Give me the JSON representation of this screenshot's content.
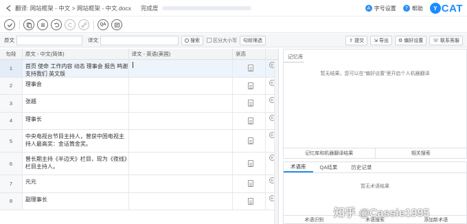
{
  "titlebar": {
    "breadcrumb": "翻译: 网站框架 - 中文 > 网站框架 - 中文.docx",
    "progress_label": "完成度",
    "progress_fraction": 0,
    "font_settings": "字号设置",
    "help": "帮助",
    "logo_badge": "Y",
    "logo_text": "CAT"
  },
  "toolbar": {
    "icons": [
      "confirm-icon",
      "copy-source-icon",
      "merge-icon",
      "undo-icon",
      "redo-icon",
      "link-icon",
      "qa-icon",
      "find-replace-icon"
    ],
    "qa_label": "QA"
  },
  "searchbar": {
    "source_label": "原文",
    "target_label": "译文",
    "search_button": "搜索",
    "case_sensitive": "区分大小写",
    "segment_filter": "句段筛选",
    "submit": "提交",
    "export": "导出",
    "preferences": "偏好设置",
    "contact": "联系客服"
  },
  "table": {
    "headers": [
      "句段",
      "原文 - 中文(简体)",
      "译文 - 英语(美国)",
      "状态"
    ],
    "rows": [
      {
        "idx": "1",
        "source": "首页 使命 工作内容 动态 理事会 报告 鸣谢 支持我们 英文版",
        "target": ""
      },
      {
        "idx": "2",
        "source": "理事会",
        "target": ""
      },
      {
        "idx": "3",
        "source": "张越",
        "target": ""
      },
      {
        "idx": "4",
        "source": "理事长",
        "target": ""
      },
      {
        "idx": "5",
        "source": "中央电视台节目主持人，曾获中国电视主持人最高奖：金话筒金奖。",
        "target": ""
      },
      {
        "idx": "6",
        "source": "曾长期主持《半边天》栏目，现为《夜线》栏目主持人。",
        "target": ""
      },
      {
        "idx": "7",
        "source": "元元",
        "target": ""
      },
      {
        "idx": "8",
        "source": "副理事长",
        "target": ""
      }
    ]
  },
  "memory_panel": {
    "tab": "记忆库",
    "message": "暂无结果，您可以在\"偏好设置\"里开启个人机器翻译",
    "footer_left": "记忆库和机器翻译结果",
    "footer_right": "相关搜索"
  },
  "term_panel": {
    "tabs": [
      "术语库",
      "QA结果",
      "历史记录"
    ],
    "message": "暂无术语结果",
    "footer_left": "术语识别",
    "footer_mid": "术语搜索",
    "footer_right": "添加新术语"
  },
  "watermark": "知乎 @Cassie1995",
  "colors": {
    "accent": "#2b8ef0",
    "logo": "#1a8cff",
    "active_row": "#eef4fb"
  }
}
